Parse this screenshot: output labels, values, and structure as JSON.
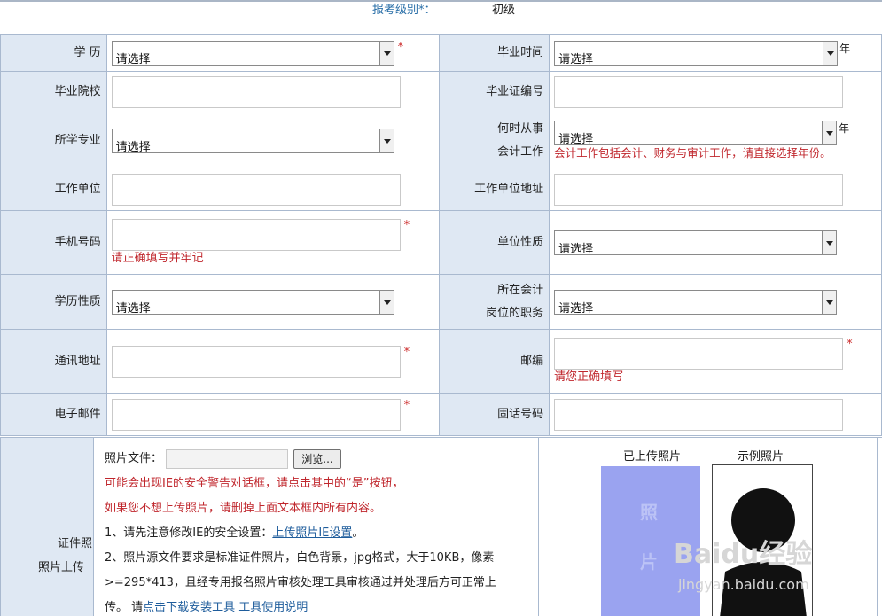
{
  "header": {
    "level_label": "报考级别*：",
    "level_value": "初级"
  },
  "select_placeholder": "请选择",
  "rows": {
    "education": {
      "label": "学 历",
      "value": "请选择",
      "required": "*"
    },
    "grad_time": {
      "label": "毕业时间",
      "value": "请选择",
      "unit": "年"
    },
    "school": {
      "label": "毕业院校"
    },
    "diploma_no": {
      "label": "毕业证编号"
    },
    "major": {
      "label": "所学专业",
      "value": "请选择"
    },
    "acct_since": {
      "label1": "何时从事",
      "label2": "会计工作",
      "value": "请选择",
      "unit": "年",
      "hint": "会计工作包括会计、财务与审计工作，请直接选择年份。"
    },
    "employer": {
      "label": "工作单位"
    },
    "employer_addr": {
      "label": "工作单位地址"
    },
    "mobile": {
      "label": "手机号码",
      "required": "*",
      "hint": "请正确填写并牢记"
    },
    "employer_type": {
      "label": "单位性质",
      "value": "请选择"
    },
    "edu_type": {
      "label": "学历性质",
      "value": "请选择"
    },
    "position": {
      "label1": "所在会计",
      "label2": "岗位的职务",
      "value": "请选择"
    },
    "address": {
      "label": "通讯地址",
      "required": "*"
    },
    "postcode": {
      "label": "邮编",
      "required": "*",
      "hint": "请您正确填写"
    },
    "email": {
      "label": "电子邮件",
      "required": "*"
    },
    "phone": {
      "label": "固话号码"
    }
  },
  "photo": {
    "label1": "证件照",
    "label2": "照片上传",
    "file_label": "照片文件：",
    "browse": "浏览...",
    "warn1": "可能会出现IE的安全警告对话框，请点击其中的“是”按钮，",
    "warn2": "如果您不想上传照片，请删掉上面文本框内所有内容。",
    "note1_prefix": "1、请先注意修改IE的安全设置：",
    "note1_link": "上传照片IE设置",
    "note1_suffix": "。",
    "note2_line1": "2、照片源文件要求是标准证件照片，白色背景，jpg格式，大于10KB，像素",
    "note2_line2": ">=295*413，且经专用报名照片审核处理工具审核通过并处理后方可正常上",
    "note2_prefix": "传。 请",
    "download_link": "点击下载安装工具",
    "usage_link": "工具使用说明",
    "uploaded_label": "已上传照片",
    "example_label": "示例照片",
    "placeholder_chars": [
      "照",
      "片"
    ]
  },
  "watermark": {
    "brand": "Baidu经验",
    "url": "jingyan.baidu.com"
  }
}
